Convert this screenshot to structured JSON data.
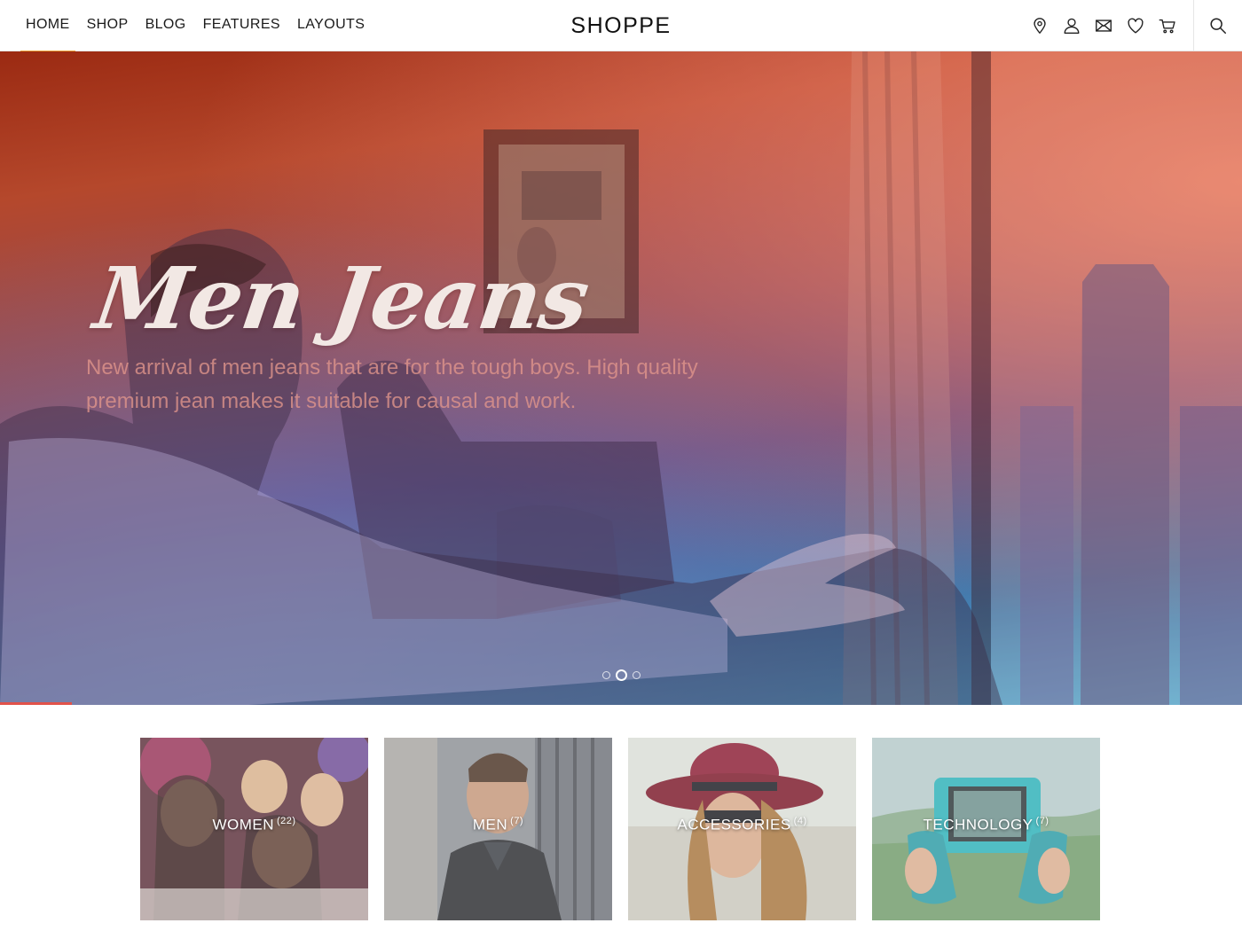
{
  "header": {
    "logo": "SHOPPE",
    "nav": [
      {
        "label": "HOME",
        "active": true
      },
      {
        "label": "SHOP",
        "active": false
      },
      {
        "label": "BLOG",
        "active": false
      },
      {
        "label": "FEATURES",
        "active": false
      },
      {
        "label": "LAYOUTS",
        "active": false
      }
    ],
    "icons": [
      "location-icon",
      "user-icon",
      "mail-icon",
      "heart-icon",
      "cart-icon",
      "search-icon"
    ],
    "accent_color": "#e9a23b"
  },
  "hero": {
    "title": "Men Jeans",
    "text": "New arrival of men jeans that are for the tough boys. High quality premium jean makes it suitable for causal and work.",
    "slides_total": 3,
    "active_slide": 2,
    "progress_fraction": 0.058,
    "progress_color": "#e1524a"
  },
  "categories": [
    {
      "name": "WOMEN",
      "count": "(22)"
    },
    {
      "name": "MEN",
      "count": "(7)"
    },
    {
      "name": "ACCESSORIES",
      "count": "(4)"
    },
    {
      "name": "TECHNOLOGY",
      "count": "(7)"
    }
  ]
}
